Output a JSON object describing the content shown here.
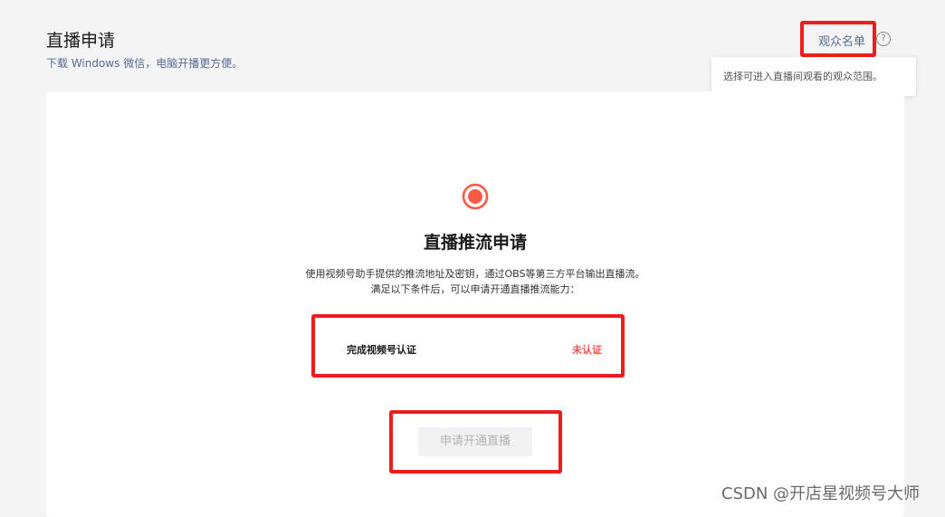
{
  "header": {
    "title": "直播申请",
    "subtitle": "下载 Windows 微信，电脑开播更方便。",
    "audience_link": "观众名单",
    "help_icon": "question-circle-icon",
    "help_glyph": "?",
    "tooltip": "选择可进入直播间观看的观众范围。"
  },
  "card": {
    "icon": "live-record-icon",
    "title": "直播推流申请",
    "desc_line1": "使用视频号助手提供的推流地址及密钥，通过OBS等第三方平台输出直播流。",
    "desc_line2": "满足以下条件后，可以申请开通直播推流能力：",
    "requirement": {
      "label": "完成视频号认证",
      "status": "未认证"
    },
    "apply_button": "申请开通直播"
  },
  "watermark": "CSDN @开店星视频号大师",
  "colors": {
    "accent_link": "#576b95",
    "status_red": "#fa5151",
    "live_icon": "#fa5a45",
    "annotation_red": "#ef1c1c",
    "page_bg": "#f4f4f4",
    "card_bg": "#ffffff",
    "disabled_text": "#b2b2b2"
  }
}
